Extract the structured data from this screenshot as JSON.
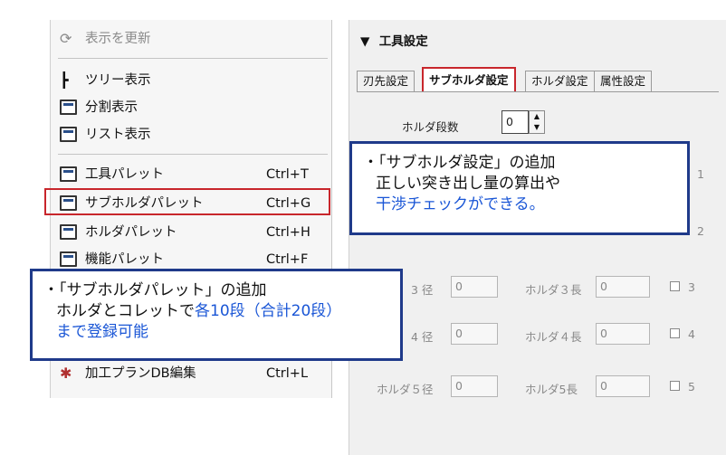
{
  "menu": {
    "refresh": {
      "label": "表示を更新"
    },
    "tree": {
      "label": "ツリー表示"
    },
    "split": {
      "label": "分割表示"
    },
    "list": {
      "label": "リスト表示"
    },
    "tool_palette": {
      "label": "工具パレット",
      "shortcut": "Ctrl+T"
    },
    "subholder_palette": {
      "label": "サブホルダパレット",
      "shortcut": "Ctrl+G"
    },
    "holder_palette": {
      "label": "ホルダパレット",
      "shortcut": "Ctrl+H"
    },
    "function_palette": {
      "label": "機能パレット",
      "shortcut": "Ctrl+F"
    },
    "plan_db_edit": {
      "label": "加工プランDB編集",
      "shortcut": "Ctrl+L"
    }
  },
  "panel": {
    "title": "工具設定",
    "tabs": [
      "刃先設定",
      "サブホルダ設定",
      "ホルダ設定",
      "属性設定"
    ],
    "stages_label": "ホルダ段数",
    "stages_value": "0",
    "rows": [
      {
        "dia_label": "3 径",
        "dia_value": "0",
        "len_label": "ホルダ３長",
        "len_value": "0",
        "check_num": "3"
      },
      {
        "dia_label": "4 径",
        "dia_value": "0",
        "len_label": "ホルダ４長",
        "len_value": "0",
        "check_num": "4"
      },
      {
        "dia_label": "ホルダ５径",
        "dia_value": "0",
        "len_label": "ホルダ5長",
        "len_value": "0",
        "check_num": "5"
      }
    ],
    "edge_digits": [
      "1",
      "2"
    ]
  },
  "callout1": {
    "line1": "・「サブホルダ設定」の追加",
    "line2": "正しい突き出し量の算出や",
    "line3": "干渉チェックができる。"
  },
  "callout2": {
    "line1": "・「サブホルダパレット」の追加",
    "line2_pre": "ホルダとコレットで",
    "line2_highlight": "各10段（合計20段）",
    "line3": "まで登録可能"
  },
  "colors": {
    "accent_red": "#c8262c",
    "callout_border": "#1f3a8a",
    "highlight_text": "#1a56d6"
  }
}
